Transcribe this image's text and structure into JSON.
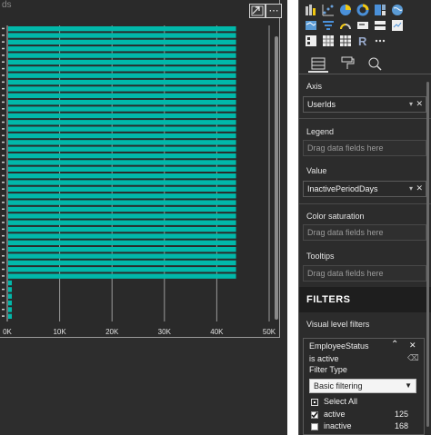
{
  "visual": {
    "title_fragment": "ds",
    "focus_icon": "focus-mode-icon",
    "more_label": "⋯"
  },
  "chart_data": {
    "type": "bar",
    "orientation": "horizontal",
    "xticks": [
      "0K",
      "10K",
      "20K",
      "30K",
      "40K",
      "50K"
    ],
    "xlim": [
      0,
      50000
    ],
    "values": [
      43500,
      43500,
      43500,
      43500,
      43500,
      43500,
      43500,
      43500,
      43500,
      43500,
      43500,
      43500,
      43500,
      43500,
      43500,
      43500,
      43500,
      43500,
      43500,
      43500,
      43500,
      43500,
      43500,
      43500,
      43500,
      43500,
      43500,
      43500,
      43500,
      43500,
      43500,
      43500,
      43500,
      43500,
      43500,
      43500,
      43500,
      43500,
      700,
      700,
      700,
      700,
      700,
      700
    ],
    "grid": true,
    "bar_color": "#01b8aa"
  },
  "panel": {
    "fields": {
      "axis_label": "Axis",
      "axis_value": "UserIds",
      "legend_label": "Legend",
      "legend_placeholder": "Drag data fields here",
      "value_label": "Value",
      "value_value": "InactivePeriodDays",
      "color_sat_label": "Color saturation",
      "color_sat_placeholder": "Drag data fields here",
      "tooltips_label": "Tooltips",
      "tooltips_placeholder": "Drag data fields here"
    },
    "filters": {
      "header": "FILTERS",
      "visual_level": "Visual level filters",
      "card_title": "EmployeeStatus",
      "summary": "is active",
      "filter_type_label": "Filter Type",
      "filter_type_value": "Basic filtering",
      "select_all": "Select All",
      "options": [
        {
          "label": "active",
          "count": "125",
          "checked": true
        },
        {
          "label": "inactive",
          "count": "168",
          "checked": false
        }
      ]
    }
  }
}
